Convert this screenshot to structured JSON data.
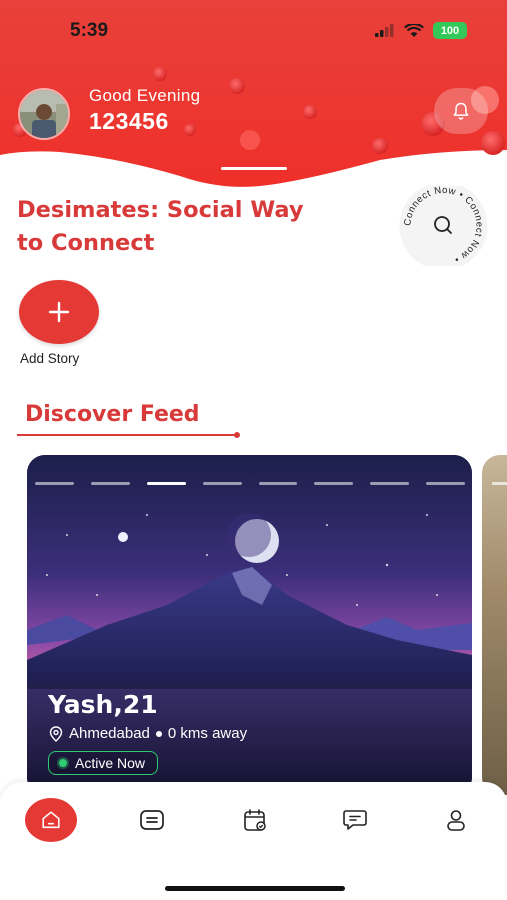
{
  "status_bar": {
    "time": "5:39",
    "battery": "100"
  },
  "header": {
    "greeting": "Good Evening",
    "username": "123456",
    "icons": [
      "avatar",
      "bell-icon"
    ],
    "accent_color": "#e8312f"
  },
  "app_title": "Desimates: Social Way to Connect",
  "connect_badge": {
    "text": "Connect Now • Connect Now •",
    "icon": "search-icon"
  },
  "add_story": {
    "label": "Add Story",
    "icon": "plus-icon"
  },
  "discover": {
    "title": "Discover Feed"
  },
  "card": {
    "name": "Yash,21",
    "location": "Ahmedabad",
    "distance": "0 kms away",
    "status": "Active Now",
    "progress_segments": 8,
    "active_segment": 3,
    "status_color": "#2ecc71"
  },
  "bottom_nav": {
    "items": [
      "home-icon",
      "feed-icon",
      "calendar-icon",
      "chat-icon",
      "profile-icon"
    ],
    "active": "home-icon"
  }
}
